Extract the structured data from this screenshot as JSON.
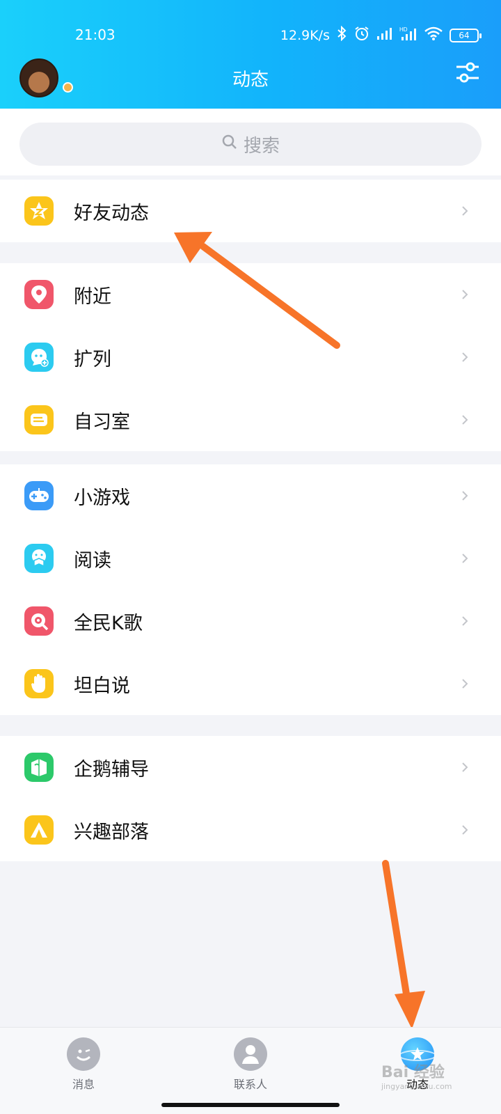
{
  "status": {
    "time": "21:03",
    "speed": "12.9K/s",
    "battery": "64"
  },
  "header": {
    "title": "动态"
  },
  "search": {
    "placeholder": "搜索"
  },
  "groups": [
    {
      "items": [
        {
          "label": "好友动态",
          "icon": "star-z-icon",
          "color": "#fbc51b"
        }
      ]
    },
    {
      "items": [
        {
          "label": "附近",
          "icon": "location-pin-icon",
          "color": "#f0566a"
        },
        {
          "label": "扩列",
          "icon": "chat-add-icon",
          "color": "#2ccbf0"
        },
        {
          "label": "自习室",
          "icon": "study-room-icon",
          "color": "#fbc51b"
        }
      ]
    },
    {
      "items": [
        {
          "label": "小游戏",
          "icon": "gamepad-icon",
          "color": "#3b9bf7"
        },
        {
          "label": "阅读",
          "icon": "reading-icon",
          "color": "#2ccbf0"
        },
        {
          "label": "全民K歌",
          "icon": "karaoke-icon",
          "color": "#f0566a"
        },
        {
          "label": "坦白说",
          "icon": "hand-icon",
          "color": "#fbc51b"
        }
      ]
    },
    {
      "items": [
        {
          "label": "企鹅辅导",
          "icon": "book-icon",
          "color": "#2cc96a"
        },
        {
          "label": "兴趣部落",
          "icon": "tent-icon",
          "color": "#fbc51b"
        }
      ]
    }
  ],
  "tabbar": {
    "tabs": [
      {
        "label": "消息",
        "icon": "message-smile-icon",
        "active": false
      },
      {
        "label": "联系人",
        "icon": "contact-person-icon",
        "active": false
      },
      {
        "label": "动态",
        "icon": "planet-star-icon",
        "active": true
      }
    ]
  },
  "watermark": {
    "main": "Bai 经验",
    "sub": "jingyan.baidu.com"
  }
}
